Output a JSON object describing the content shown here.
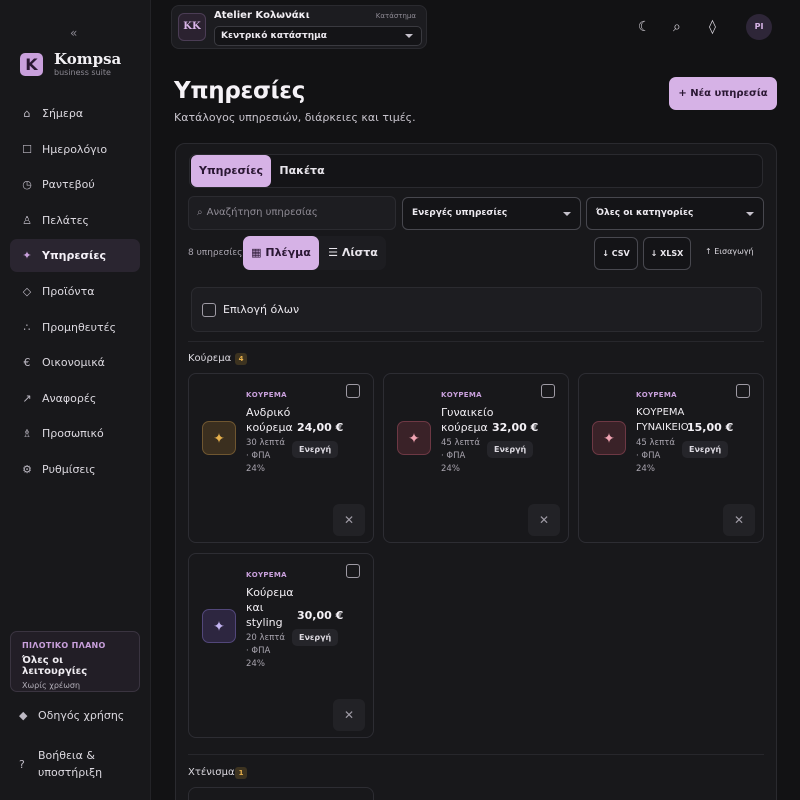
{
  "sidebar": {
    "collapse_icon": "«",
    "brand": {
      "initial": "K",
      "name": "Kompsa",
      "sub": "business suite"
    },
    "items": [
      {
        "label": "Σήμερα",
        "icon": "home-icon",
        "glyph": "⌂"
      },
      {
        "label": "Ημερολόγιο",
        "icon": "calendar-icon",
        "glyph": "☐"
      },
      {
        "label": "Ραντεβού",
        "icon": "clock-icon",
        "glyph": "◷"
      },
      {
        "label": "Πελάτες",
        "icon": "person-icon",
        "glyph": "♙"
      },
      {
        "label": "Υπηρεσίες",
        "icon": "sparkle-icon",
        "glyph": "✦",
        "active": true
      },
      {
        "label": "Προϊόντα",
        "icon": "diamond-icon",
        "glyph": "◇"
      },
      {
        "label": "Προμηθευτές",
        "icon": "dots-icon",
        "glyph": "∴"
      },
      {
        "label": "Οικονομικά",
        "icon": "euro-icon",
        "glyph": "€"
      },
      {
        "label": "Αναφορές",
        "icon": "trend-icon",
        "glyph": "↗"
      },
      {
        "label": "Προσωπικό",
        "icon": "staff-icon",
        "glyph": "♗"
      },
      {
        "label": "Ρυθμίσεις",
        "icon": "settings-icon",
        "glyph": "⚙"
      }
    ],
    "plan": {
      "title": "ΠΙΛΟΤΙΚΟ ΠΛΑΝΟ",
      "desc": "Όλες οι λειτουργίες",
      "sub": "Χωρίς χρέωση"
    },
    "guide": {
      "label": "Οδηγός χρήσης",
      "glyph": "◆"
    },
    "help": {
      "label_line1": "Βοήθεια &",
      "label_line2": "υποστήριξη",
      "glyph": "?"
    }
  },
  "topbar": {
    "store_initials": "KK",
    "store_name": "Atelier Κολωνάκι",
    "store_role": "Κατάστημα",
    "branch": "Κεντρικό κατάστημα",
    "icons": {
      "theme": "☾",
      "search": "⌕",
      "diamond": "◊"
    },
    "user_initials": "PI"
  },
  "header": {
    "title": "Υπηρεσίες",
    "subtitle": "Κατάλογος υπηρεσιών, διάρκειες και τιμές.",
    "new_button": "+ Νέα υπηρεσία"
  },
  "tabs": [
    "Υπηρεσίες",
    "Πακέτα"
  ],
  "filters": {
    "search_placeholder": "Αναζήτηση υπηρεσίας",
    "status_select": "Ενεργές υπηρεσίες",
    "category_select": "Όλες οι κατηγορίες"
  },
  "toolbar": {
    "count": "8 υπηρεσίες",
    "grid": "▦ Πλέγμα",
    "list": "☰ Λίστα",
    "csv": "↓ CSV",
    "xlsx": "↓ XLSX",
    "import": "↑ Εισαγωγή"
  },
  "select_all": "Επιλογή όλων",
  "groups": [
    {
      "name": "Κούρεμα",
      "count": "4",
      "services": [
        {
          "category": "ΚΟΥΡΕΜΑ",
          "name": "Ανδρικό κούρεμα",
          "price": "24,00 €",
          "meta": "30 λεπτά · ΦΠΑ 24%",
          "status": "Ενεργή",
          "tone": "gold",
          "glyph": "✦"
        },
        {
          "category": "ΚΟΥΡΕΜΑ",
          "name": "Γυναικείο κούρεμα",
          "price": "32,00 €",
          "meta": "45 λεπτά · ΦΠΑ 24%",
          "status": "Ενεργή",
          "tone": "rose",
          "glyph": "✦"
        },
        {
          "category": "ΚΟΥΡΕΜΑ",
          "name": "ΚΟΥΡΕΜΑ ΓΥΝΑΙΚΕΙΟ",
          "price": "15,00 €",
          "meta": "45 λεπτά · ΦΠΑ 24%",
          "status": "Ενεργή",
          "tone": "rose",
          "glyph": "✦"
        },
        {
          "category": "ΚΟΥΡΕΜΑ",
          "name": "Κούρεμα και styling",
          "price": "30,00 €",
          "meta": "20 λεπτά · ΦΠΑ 24%",
          "status": "Ενεργή",
          "tone": "violet",
          "glyph": "✦"
        }
      ]
    },
    {
      "name": "Χτένισμα",
      "count": "1"
    }
  ],
  "colors": {
    "accent": "#d6b2e6",
    "background": "#121214",
    "sidebar": "#18181b",
    "badge": "#e6b04c"
  }
}
